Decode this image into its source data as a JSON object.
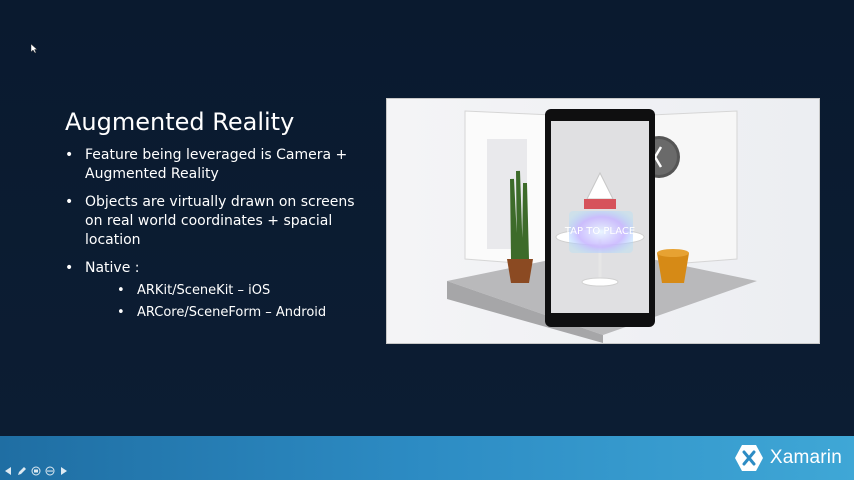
{
  "slide": {
    "title": "Augmented Reality",
    "bullets": [
      {
        "text": "Feature being leveraged is Camera + Augmented Reality"
      },
      {
        "text": "Objects are virtually drawn on screens on real world coordinates + spacial location"
      },
      {
        "text": "Native :",
        "sub": [
          "ARKit/SceneKit – iOS",
          "ARCore/SceneForm – Android"
        ]
      }
    ]
  },
  "ar_demo": {
    "overlay_text": "TAP TO PLACE"
  },
  "footer": {
    "brand": "Xamarin",
    "colors": {
      "start": "#1f6ea3",
      "end": "#3fa7d6",
      "background": "#0b1a2e"
    }
  },
  "nav_icons": [
    "previous-icon",
    "pen-icon",
    "slides-icon",
    "options-icon",
    "next-icon"
  ]
}
